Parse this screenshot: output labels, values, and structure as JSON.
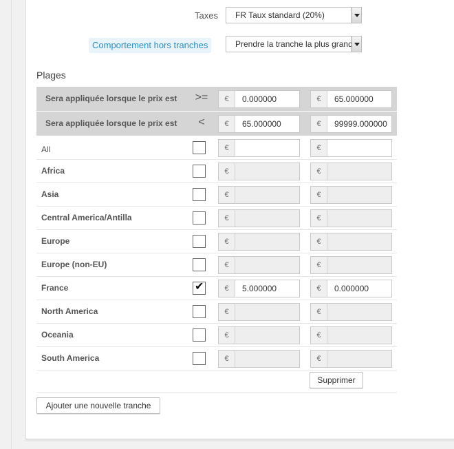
{
  "taxes": {
    "label": "Taxes",
    "selected": "FR Taux standard (20%)"
  },
  "behavior": {
    "label": "Comportement hors tranches",
    "selected": "Prendre la tranche la plus grande"
  },
  "ranges": {
    "title": "Plages",
    "currency": "€",
    "header_rows": [
      {
        "label": "Sera appliquée lorsque le prix est",
        "operator": ">=",
        "from": "0.000000",
        "to": "65.000000"
      },
      {
        "label": "Sera appliquée lorsque le prix est",
        "operator": "<",
        "from": "65.000000",
        "to": "99999.000000"
      }
    ],
    "zones": [
      {
        "name": "All",
        "checked": false,
        "from": "",
        "to": "",
        "enabled": true
      },
      {
        "name": "Africa",
        "checked": false,
        "from": "",
        "to": "",
        "enabled": false
      },
      {
        "name": "Asia",
        "checked": false,
        "from": "",
        "to": "",
        "enabled": false
      },
      {
        "name": "Central America/Antilla",
        "checked": false,
        "from": "",
        "to": "",
        "enabled": false
      },
      {
        "name": "Europe",
        "checked": false,
        "from": "",
        "to": "",
        "enabled": false
      },
      {
        "name": "Europe (non-EU)",
        "checked": false,
        "from": "",
        "to": "",
        "enabled": false
      },
      {
        "name": "France",
        "checked": true,
        "from": "5.000000",
        "to": "0.000000",
        "enabled": true
      },
      {
        "name": "North America",
        "checked": false,
        "from": "",
        "to": "",
        "enabled": false
      },
      {
        "name": "Oceania",
        "checked": false,
        "from": "",
        "to": "",
        "enabled": false
      },
      {
        "name": "South America",
        "checked": false,
        "from": "",
        "to": "",
        "enabled": false
      }
    ],
    "check_glyph": "✔",
    "delete_label": "Supprimer",
    "add_label": "Ajouter une nouvelle tranche"
  }
}
